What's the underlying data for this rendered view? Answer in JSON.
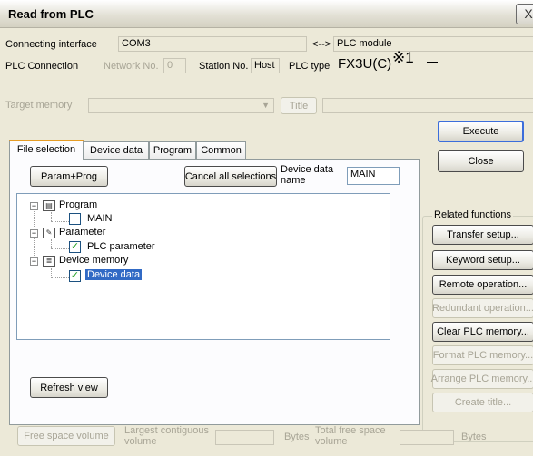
{
  "window": {
    "title": "Read from PLC",
    "close_glyph": "X"
  },
  "connection": {
    "interface_label": "Connecting interface",
    "interface_value": "COM3",
    "arrow_text": "<-->",
    "target_value": "PLC module",
    "plc_connection_label": "PLC Connection",
    "network_label": "Network No.",
    "network_value": "0",
    "station_label": "Station No.",
    "station_value": "Host",
    "plc_type_label": "PLC type",
    "plc_type_value": "FX3U(C)",
    "annotation": "※1"
  },
  "target": {
    "memory_label": "Target memory",
    "title_button": "Title"
  },
  "tabs": [
    "File selection",
    "Device data",
    "Program",
    "Common"
  ],
  "file_selection": {
    "param_prog_button": "Param+Prog",
    "cancel_button": "Cancel all selections",
    "device_data_name_label": "Device data name",
    "device_data_name_value": "MAIN",
    "tree": [
      {
        "label": "Program",
        "expander": "−",
        "icon": "program-icon"
      },
      {
        "label": "MAIN",
        "checked": false
      },
      {
        "label": "Parameter",
        "expander": "−",
        "icon": "parameter-icon"
      },
      {
        "label": "PLC parameter",
        "checked": true
      },
      {
        "label": "Device memory",
        "expander": "−",
        "icon": "device-memory-icon"
      },
      {
        "label": "Device data",
        "checked": true,
        "selected": true
      }
    ],
    "refresh_button": "Refresh view"
  },
  "actions": {
    "execute": "Execute",
    "close": "Close"
  },
  "related": {
    "group_label": "Related functions",
    "buttons": [
      {
        "label": "Transfer setup...",
        "enabled": true
      },
      {
        "label": "Keyword setup...",
        "enabled": true
      },
      {
        "label": "Remote operation...",
        "enabled": true
      },
      {
        "label": "Redundant operation...",
        "enabled": false
      },
      {
        "label": "Clear PLC memory...",
        "enabled": true
      },
      {
        "label": "Format PLC memory...",
        "enabled": false
      },
      {
        "label": "Arrange PLC memory...",
        "enabled": false
      },
      {
        "label": "Create title...",
        "enabled": false
      }
    ]
  },
  "footer": {
    "free_space_button": "Free space volume",
    "largest_label": "Largest contiguous volume",
    "bytes1": "Bytes",
    "total_label": "Total free space volume",
    "bytes2": "Bytes"
  },
  "colors": {
    "dialog_bg": "#ece9d8",
    "focus_border": "#3c6edb",
    "check": "#21a121",
    "selection": "#316ac5"
  }
}
